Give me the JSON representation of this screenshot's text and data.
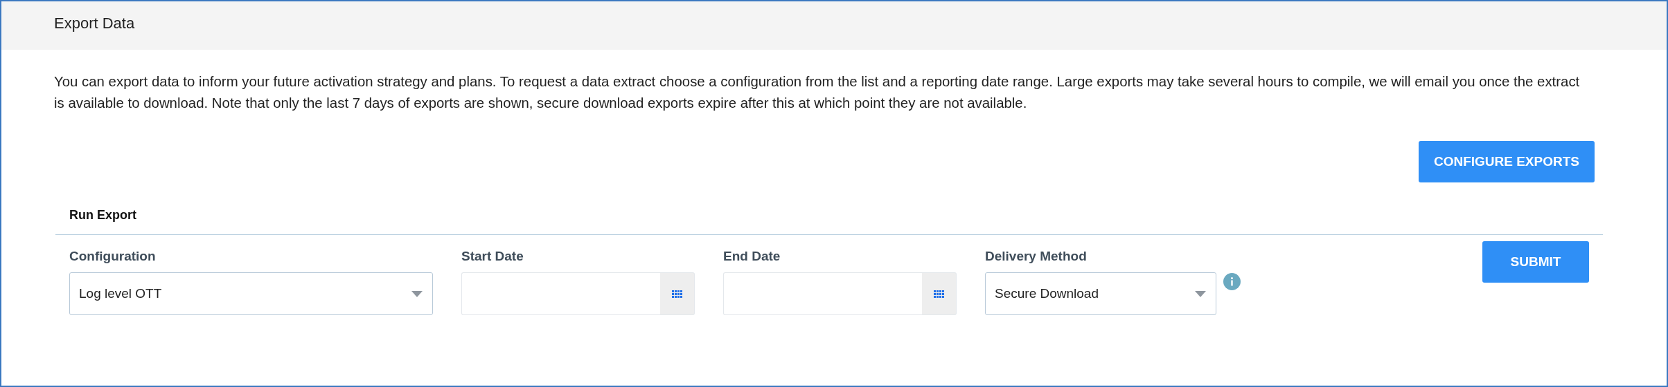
{
  "header": {
    "title": "Export Data"
  },
  "description": "You can export data to inform your future activation strategy and plans. To request a data extract choose a configuration from the list and a reporting date range. Large exports may take several hours to compile, we will email you once the extract is available to download. Note that only the last 7 days of exports are shown, secure download exports expire after this at which point they are not available.",
  "configure_button": "CONFIGURE EXPORTS",
  "run_export": {
    "title": "Run Export",
    "fields": [
      {
        "kind": "select",
        "label": "Configuration",
        "value": "Log level OTT"
      },
      {
        "kind": "date",
        "label": "Start Date"
      },
      {
        "kind": "date",
        "label": "End Date"
      },
      {
        "kind": "select",
        "label": "Delivery Method",
        "value": "Secure Download",
        "info": true
      }
    ],
    "submit_button": "SUBMIT"
  }
}
